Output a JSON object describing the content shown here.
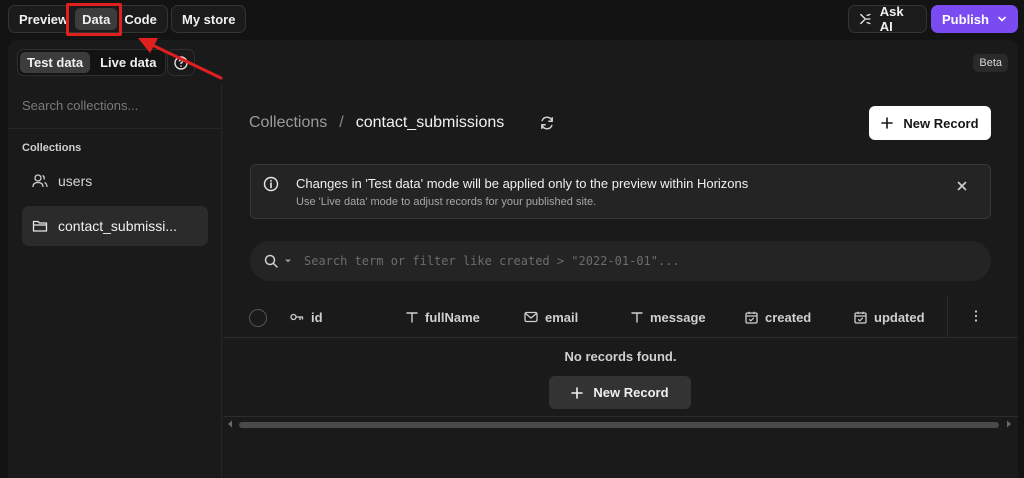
{
  "topbar": {
    "tabs": [
      {
        "label": "Preview"
      },
      {
        "label": "Data"
      },
      {
        "label": "Code"
      }
    ],
    "my_store": "My store",
    "ask_ai": "Ask AI",
    "publish": "Publish"
  },
  "mode": {
    "test": "Test data",
    "live": "Live data",
    "beta": "Beta"
  },
  "sidebar": {
    "search_placeholder": "Search collections...",
    "heading": "Collections",
    "items": [
      {
        "label": "users",
        "icon": "users-icon"
      },
      {
        "label": "contact_submissi...",
        "icon": "folder-icon"
      }
    ]
  },
  "breadcrumb": {
    "root": "Collections",
    "separator": "/",
    "current": "contact_submissions"
  },
  "new_record": "New Record",
  "banner": {
    "title": "Changes in 'Test data' mode will be applied only to the preview within Horizons",
    "subtitle": "Use 'Live data' mode to adjust records for your published site."
  },
  "search": {
    "placeholder": "Search term or filter like created > \"2022-01-01\"..."
  },
  "table": {
    "columns": [
      {
        "label": "id",
        "icon": "key-icon"
      },
      {
        "label": "fullName",
        "icon": "text-type-icon"
      },
      {
        "label": "email",
        "icon": "mail-icon"
      },
      {
        "label": "message",
        "icon": "text-type-icon"
      },
      {
        "label": "created",
        "icon": "calendar-check-icon"
      },
      {
        "label": "updated",
        "icon": "calendar-check-icon"
      }
    ],
    "empty": "No records found."
  },
  "colors": {
    "accent": "#7a4bf0",
    "annotation": "#e0201f"
  }
}
